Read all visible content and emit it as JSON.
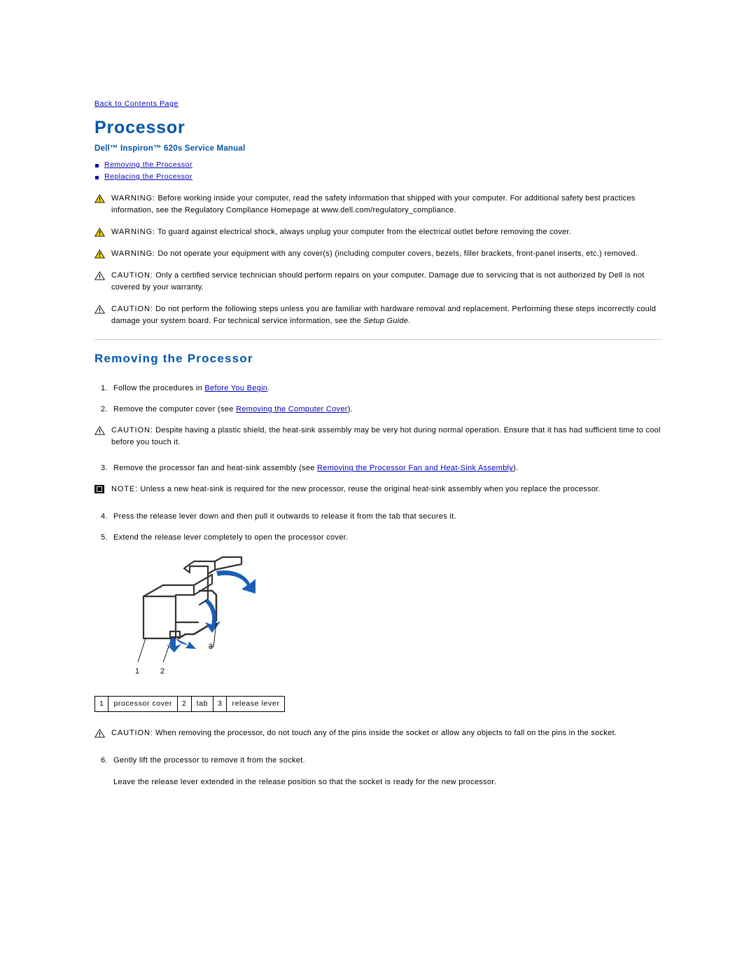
{
  "page": {
    "back_link": "Back to Contents Page",
    "title": "Processor",
    "subtitle": "Dell™ Inspiron™ 620s Service Manual",
    "toc": [
      {
        "label": "Removing the Processor"
      },
      {
        "label": "Replacing the Processor"
      }
    ],
    "notices_top": [
      {
        "icon": "warning-triangle-icon",
        "keyword": "WARNING:",
        "text": " Before working inside your computer, read the safety information that shipped with your computer. For additional safety best practices information, see the Regulatory Compliance Homepage at www.dell.com/regulatory_compliance."
      },
      {
        "icon": "warning-triangle-icon",
        "keyword": "WARNING:",
        "text": " To guard against electrical shock, always unplug your computer from the electrical outlet before removing the cover."
      },
      {
        "icon": "warning-triangle-icon",
        "keyword": "WARNING:",
        "text": " Do not operate your equipment with any cover(s) (including computer covers, bezels, filler brackets, front-panel inserts, etc.) removed."
      },
      {
        "icon": "warning-triangle-icon",
        "keyword": "CAUTION:",
        "text": " Only a certified service technician should perform repairs on your computer. Damage due to servicing that is not authorized by Dell is not covered by your warranty."
      },
      {
        "icon": "warning-triangle-icon",
        "keyword": "CAUTION:",
        "text": " Do not perform the following steps unless you are familiar with hardware removal and replacement. Performing these steps incorrectly could damage your system board. For technical service information, see the ",
        "text_italic": "Setup Guide",
        "text_after": "."
      }
    ],
    "section_heading": "Removing the Processor",
    "steps_1": [
      {
        "num": "1.",
        "pre": "Follow the procedures in ",
        "link": "Before You Begin",
        "post": "."
      },
      {
        "num": "2.",
        "pre": "Remove the computer cover (see ",
        "link": "Removing the Computer Cover",
        "post": ")."
      }
    ],
    "notice_mid": {
      "icon": "warning-triangle-icon",
      "keyword": "CAUTION:",
      "text": " Despite having a plastic shield, the heat-sink assembly may be very hot during normal operation. Ensure that it has had sufficient time to cool before you touch it."
    },
    "steps_2": [
      {
        "num": "3.",
        "pre": "Remove the processor fan and heat-sink assembly (see ",
        "link": "Removing the Processor Fan and Heat-Sink Assembly",
        "post": ")."
      }
    ],
    "notice_note": {
      "icon": "note-icon",
      "keyword": "NOTE:",
      "text": " Unless a new heat-sink is required for the new processor, reuse the original heat-sink assembly when you replace the processor."
    },
    "steps_3": [
      {
        "num": "4.",
        "pre": "Press the release lever down and then pull it outwards to release it from the tab that secures it.",
        "link": "",
        "post": ""
      },
      {
        "num": "5.",
        "pre": "Extend the release lever completely to open the processor cover.",
        "link": "",
        "post": ""
      }
    ],
    "figure": {
      "name": "processor-socket-diagram",
      "callouts": [
        "1",
        "2",
        "3"
      ]
    },
    "legend": [
      {
        "num": "1",
        "label": "processor cover"
      },
      {
        "num": "2",
        "label": "tab"
      },
      {
        "num": "3",
        "label": "release lever"
      }
    ],
    "notice_bottom": {
      "icon": "warning-triangle-icon",
      "keyword": "CAUTION:",
      "text": " When removing the processor, do not touch any of the pins inside the socket or allow any objects to fall on the pins in the socket."
    },
    "steps_4": [
      {
        "num": "6.",
        "pre": "Gently lift the processor to remove it from the socket.",
        "link": "",
        "post": ""
      }
    ],
    "closing_para": "Leave the release lever extended in the release position so that the socket is ready for the new processor.",
    "colors": {
      "heading": "#0055aa",
      "link": "#0000bb",
      "rule": "#cccccc"
    }
  }
}
